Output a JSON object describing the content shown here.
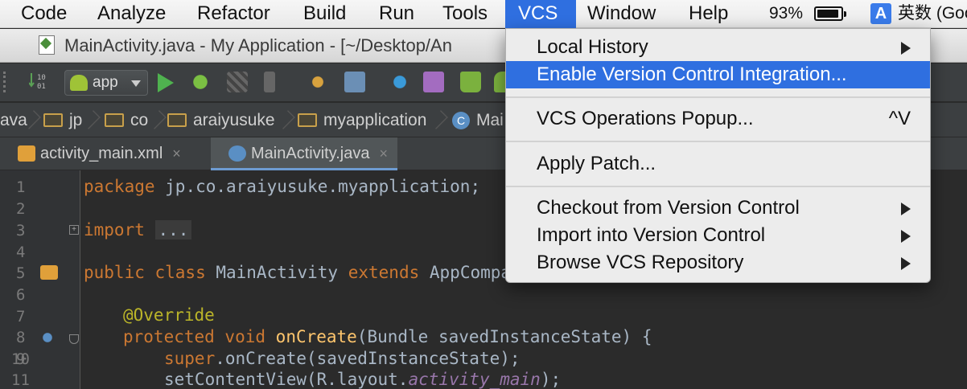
{
  "menubar": {
    "items": [
      {
        "label": "Code"
      },
      {
        "label": "Analyze"
      },
      {
        "label": "Refactor"
      },
      {
        "label": "Build"
      },
      {
        "label": "Run"
      },
      {
        "label": "Tools"
      },
      {
        "label": "VCS"
      },
      {
        "label": "Window"
      },
      {
        "label": "Help"
      }
    ],
    "battery_percent": "93%",
    "battery_level": 0.93,
    "input_source_label": "A",
    "input_name": "英数 (Goo"
  },
  "window": {
    "title": "MainActivity.java - My Application - [~/Desktop/An"
  },
  "toolbar": {
    "run_config": "app"
  },
  "navbar": {
    "crumbs": [
      "ava",
      "jp",
      "co",
      "araiyusuke",
      "myapplication",
      "Mai"
    ]
  },
  "tabs": [
    {
      "label": "activity_main.xml",
      "close": "×"
    },
    {
      "label": "MainActivity.java",
      "close": "×"
    }
  ],
  "editor": {
    "line_numbers": [
      "1",
      "2",
      "3",
      "4",
      "5",
      "6",
      "7",
      "8",
      "9",
      "10",
      "11"
    ],
    "line1": {
      "kw": "package",
      "rest": " jp.co.araiyusuke.myapplication;"
    },
    "line3": {
      "kw": "import",
      "fold": "..."
    },
    "line6": {
      "kw1": "public class",
      "cls": " MainActivity ",
      "kw2": "extends",
      "rest": " AppCompa"
    },
    "line8": {
      "ann": "@Override"
    },
    "line9": {
      "kw": "protected void",
      "fn": "onCreate",
      "rest": "(Bundle savedInstanceState) {"
    },
    "line10": {
      "kw": "super",
      "rest": ".onCreate(savedInstanceState);"
    },
    "line11": {
      "pre": "setContentView(R.layout.",
      "fld": "activity_main",
      "post": ");"
    }
  },
  "vcs_menu": {
    "local_history": "Local History",
    "enable_vcs": "Enable Version Control Integration...",
    "operations_popup": "VCS Operations Popup...",
    "operations_shortcut": "^V",
    "apply_patch": "Apply Patch...",
    "checkout": "Checkout from Version Control",
    "import": "Import into Version Control",
    "browse": "Browse VCS Repository"
  }
}
